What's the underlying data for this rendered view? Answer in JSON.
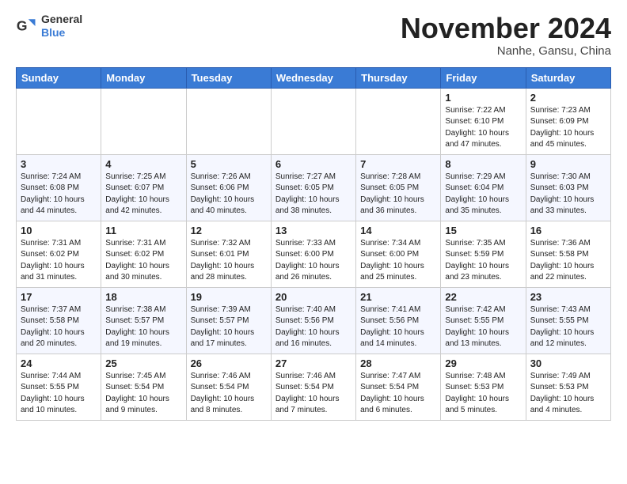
{
  "header": {
    "logo_general": "General",
    "logo_blue": "Blue",
    "month_title": "November 2024",
    "location": "Nanhe, Gansu, China"
  },
  "calendar": {
    "headers": [
      "Sunday",
      "Monday",
      "Tuesday",
      "Wednesday",
      "Thursday",
      "Friday",
      "Saturday"
    ],
    "weeks": [
      [
        {
          "day": "",
          "info": ""
        },
        {
          "day": "",
          "info": ""
        },
        {
          "day": "",
          "info": ""
        },
        {
          "day": "",
          "info": ""
        },
        {
          "day": "",
          "info": ""
        },
        {
          "day": "1",
          "info": "Sunrise: 7:22 AM\nSunset: 6:10 PM\nDaylight: 10 hours and 47 minutes."
        },
        {
          "day": "2",
          "info": "Sunrise: 7:23 AM\nSunset: 6:09 PM\nDaylight: 10 hours and 45 minutes."
        }
      ],
      [
        {
          "day": "3",
          "info": "Sunrise: 7:24 AM\nSunset: 6:08 PM\nDaylight: 10 hours and 44 minutes."
        },
        {
          "day": "4",
          "info": "Sunrise: 7:25 AM\nSunset: 6:07 PM\nDaylight: 10 hours and 42 minutes."
        },
        {
          "day": "5",
          "info": "Sunrise: 7:26 AM\nSunset: 6:06 PM\nDaylight: 10 hours and 40 minutes."
        },
        {
          "day": "6",
          "info": "Sunrise: 7:27 AM\nSunset: 6:05 PM\nDaylight: 10 hours and 38 minutes."
        },
        {
          "day": "7",
          "info": "Sunrise: 7:28 AM\nSunset: 6:05 PM\nDaylight: 10 hours and 36 minutes."
        },
        {
          "day": "8",
          "info": "Sunrise: 7:29 AM\nSunset: 6:04 PM\nDaylight: 10 hours and 35 minutes."
        },
        {
          "day": "9",
          "info": "Sunrise: 7:30 AM\nSunset: 6:03 PM\nDaylight: 10 hours and 33 minutes."
        }
      ],
      [
        {
          "day": "10",
          "info": "Sunrise: 7:31 AM\nSunset: 6:02 PM\nDaylight: 10 hours and 31 minutes."
        },
        {
          "day": "11",
          "info": "Sunrise: 7:31 AM\nSunset: 6:02 PM\nDaylight: 10 hours and 30 minutes."
        },
        {
          "day": "12",
          "info": "Sunrise: 7:32 AM\nSunset: 6:01 PM\nDaylight: 10 hours and 28 minutes."
        },
        {
          "day": "13",
          "info": "Sunrise: 7:33 AM\nSunset: 6:00 PM\nDaylight: 10 hours and 26 minutes."
        },
        {
          "day": "14",
          "info": "Sunrise: 7:34 AM\nSunset: 6:00 PM\nDaylight: 10 hours and 25 minutes."
        },
        {
          "day": "15",
          "info": "Sunrise: 7:35 AM\nSunset: 5:59 PM\nDaylight: 10 hours and 23 minutes."
        },
        {
          "day": "16",
          "info": "Sunrise: 7:36 AM\nSunset: 5:58 PM\nDaylight: 10 hours and 22 minutes."
        }
      ],
      [
        {
          "day": "17",
          "info": "Sunrise: 7:37 AM\nSunset: 5:58 PM\nDaylight: 10 hours and 20 minutes."
        },
        {
          "day": "18",
          "info": "Sunrise: 7:38 AM\nSunset: 5:57 PM\nDaylight: 10 hours and 19 minutes."
        },
        {
          "day": "19",
          "info": "Sunrise: 7:39 AM\nSunset: 5:57 PM\nDaylight: 10 hours and 17 minutes."
        },
        {
          "day": "20",
          "info": "Sunrise: 7:40 AM\nSunset: 5:56 PM\nDaylight: 10 hours and 16 minutes."
        },
        {
          "day": "21",
          "info": "Sunrise: 7:41 AM\nSunset: 5:56 PM\nDaylight: 10 hours and 14 minutes."
        },
        {
          "day": "22",
          "info": "Sunrise: 7:42 AM\nSunset: 5:55 PM\nDaylight: 10 hours and 13 minutes."
        },
        {
          "day": "23",
          "info": "Sunrise: 7:43 AM\nSunset: 5:55 PM\nDaylight: 10 hours and 12 minutes."
        }
      ],
      [
        {
          "day": "24",
          "info": "Sunrise: 7:44 AM\nSunset: 5:55 PM\nDaylight: 10 hours and 10 minutes."
        },
        {
          "day": "25",
          "info": "Sunrise: 7:45 AM\nSunset: 5:54 PM\nDaylight: 10 hours and 9 minutes."
        },
        {
          "day": "26",
          "info": "Sunrise: 7:46 AM\nSunset: 5:54 PM\nDaylight: 10 hours and 8 minutes."
        },
        {
          "day": "27",
          "info": "Sunrise: 7:46 AM\nSunset: 5:54 PM\nDaylight: 10 hours and 7 minutes."
        },
        {
          "day": "28",
          "info": "Sunrise: 7:47 AM\nSunset: 5:54 PM\nDaylight: 10 hours and 6 minutes."
        },
        {
          "day": "29",
          "info": "Sunrise: 7:48 AM\nSunset: 5:53 PM\nDaylight: 10 hours and 5 minutes."
        },
        {
          "day": "30",
          "info": "Sunrise: 7:49 AM\nSunset: 5:53 PM\nDaylight: 10 hours and 4 minutes."
        }
      ]
    ]
  }
}
